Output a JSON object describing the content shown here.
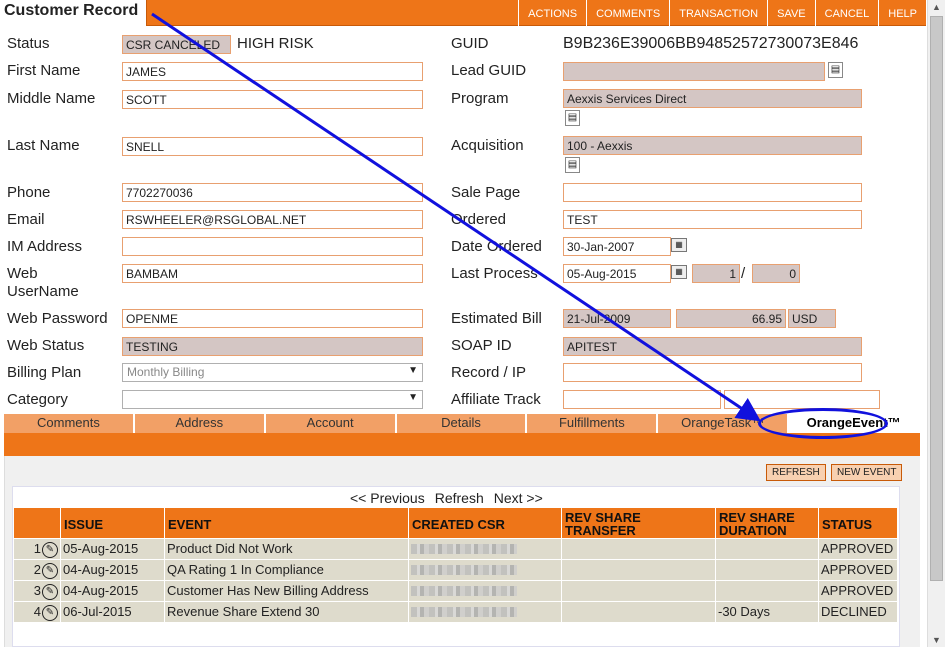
{
  "title": "Customer Record",
  "topmenu": [
    "ACTIONS",
    "COMMENTS",
    "TRANSACTION",
    "SAVE",
    "CANCEL",
    "HELP"
  ],
  "left": {
    "status_label": "Status",
    "status_value": "CSR CANCELED",
    "status_risk": "HIGH RISK",
    "first_name_label": "First Name",
    "first_name": "JAMES",
    "middle_name_label": "Middle Name",
    "middle_name": "SCOTT",
    "last_name_label": "Last Name",
    "last_name": "SNELL",
    "phone_label": "Phone",
    "phone": "7702270036",
    "email_label": "Email",
    "email": "RSWHEELER@RSGLOBAL.NET",
    "im_label": "IM Address",
    "im": "",
    "web_user_label_1": "Web",
    "web_user_label_2": "UserName",
    "web_user": "BAMBAM",
    "web_password_label": "Web Password",
    "web_password": "OPENME",
    "web_status_label": "Web Status",
    "web_status": "TESTING",
    "billing_plan_label": "Billing Plan",
    "billing_plan": "Monthly Billing",
    "category_label": "Category",
    "category": ""
  },
  "right": {
    "guid_label": "GUID",
    "guid": "B9B236E39006BB94852572730073E846",
    "lead_guid_label": "Lead GUID",
    "lead_guid": "",
    "program_label": "Program",
    "program": "Aexxis Services Direct",
    "acquisition_label": "Acquisition",
    "acquisition": "100 - Aexxis",
    "sale_page_label": "Sale Page",
    "sale_page": "",
    "ordered_label": "Ordered",
    "ordered": "TEST",
    "date_ordered_label": "Date Ordered",
    "date_ordered": "30-Jan-2007",
    "last_process_label": "Last Process",
    "last_process": "05-Aug-2015",
    "process_count": "1",
    "process_sep": "/",
    "process_total": "0",
    "estimated_bill_label": "Estimated Bill",
    "bill_date": "21-Jul-2009",
    "bill_amount": "66.95",
    "bill_currency": "USD",
    "soap_id_label": "SOAP ID",
    "soap_id": "APITEST",
    "record_ip_label": "Record / IP",
    "record_ip": "",
    "affiliate_label": "Affiliate Track",
    "affiliate": ""
  },
  "tabs": [
    "Comments",
    "Address",
    "Account",
    "Details",
    "Fulfillments",
    "OrangeTask™",
    "OrangeEvent™"
  ],
  "panel": {
    "refresh": "REFRESH",
    "new_event": "NEW EVENT",
    "prev": "<< Previous",
    "refresh_link": "Refresh",
    "next": "Next >>"
  },
  "table": {
    "headers": [
      "ISSUE",
      "EVENT",
      "CREATED CSR",
      "REV SHARE TRANSFER",
      "REV SHARE DURATION",
      "STATUS"
    ],
    "rows": [
      {
        "n": "1",
        "issue": "05-Aug-2015",
        "event": "Product Did Not Work",
        "transfer": "",
        "duration": "",
        "status": "APPROVED"
      },
      {
        "n": "2",
        "issue": "04-Aug-2015",
        "event": "QA Rating 1 In Compliance",
        "transfer": "",
        "duration": "",
        "status": "APPROVED"
      },
      {
        "n": "3",
        "issue": "04-Aug-2015",
        "event": "Customer Has New Billing Address",
        "transfer": "",
        "duration": "",
        "status": "APPROVED"
      },
      {
        "n": "4",
        "issue": "06-Jul-2015",
        "event": "Revenue Share Extend 30",
        "transfer": "",
        "duration": "-30 Days",
        "status": "DECLINED"
      }
    ]
  },
  "colors": {
    "accent": "#ee7518",
    "annotation": "#1111dd",
    "readonly": "#d4c6c4"
  }
}
